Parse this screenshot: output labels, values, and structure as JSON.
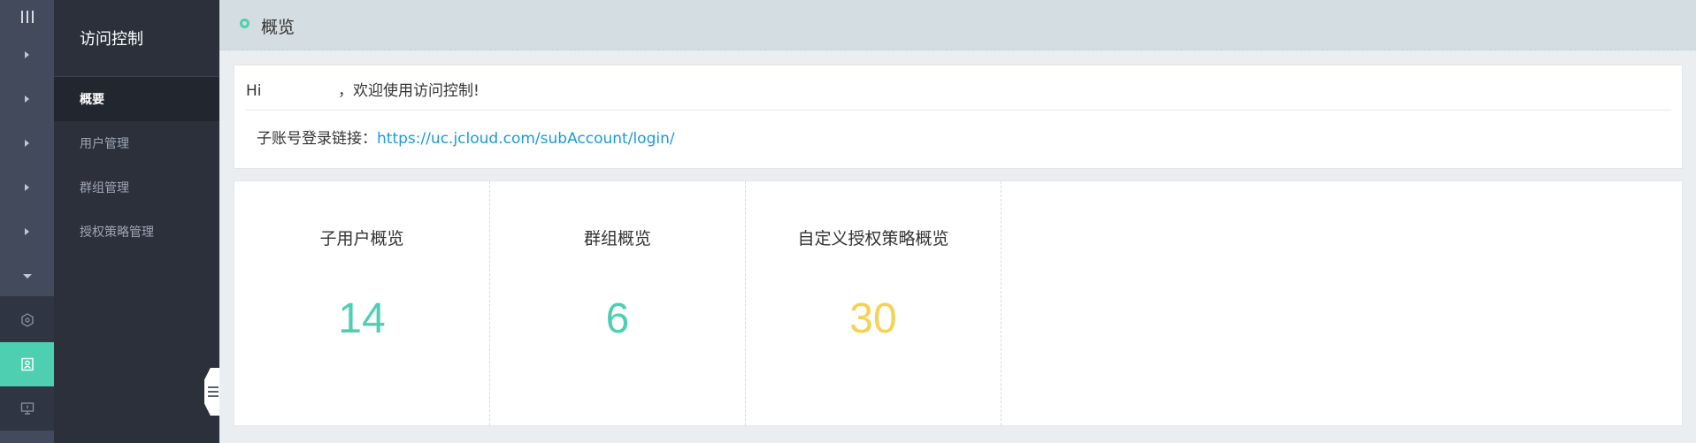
{
  "rail": {
    "items": [
      {
        "icon": "caret-right-icon"
      },
      {
        "icon": "caret-right-icon"
      },
      {
        "icon": "caret-right-icon"
      },
      {
        "icon": "caret-right-icon"
      },
      {
        "icon": "caret-right-icon"
      },
      {
        "icon": "caret-down-icon"
      }
    ],
    "icons": [
      {
        "icon": "hexagon-star-icon",
        "active": false
      },
      {
        "icon": "user-card-icon",
        "active": true
      },
      {
        "icon": "monitor-icon",
        "active": false
      }
    ],
    "accent": "#4fcfb1"
  },
  "sidebar": {
    "title": "访问控制",
    "items": [
      {
        "label": "概要",
        "active": true
      },
      {
        "label": "用户管理",
        "active": false
      },
      {
        "label": "群组管理",
        "active": false
      },
      {
        "label": "授权策略管理",
        "active": false
      }
    ]
  },
  "header": {
    "title": "概览"
  },
  "welcome": {
    "greeting_prefix": "Hi",
    "greeting_suffix": "，欢迎使用访问控制!",
    "login_label": "子账号登录链接：",
    "login_url": "https://uc.jcloud.com/subAccount/login/"
  },
  "stats": [
    {
      "label": "子用户概览",
      "value": "14",
      "color": "#4fcfb1"
    },
    {
      "label": "群组概览",
      "value": "6",
      "color": "#4fcfb1"
    },
    {
      "label": "自定义授权策略概览",
      "value": "30",
      "color": "#f7d154"
    }
  ]
}
